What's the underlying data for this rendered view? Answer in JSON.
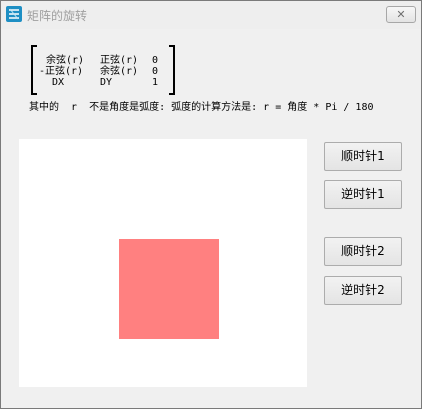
{
  "window": {
    "title": "矩阵的旋转",
    "close_label": "✕"
  },
  "matrix": {
    "rows": [
      [
        "余弦(r)",
        "正弦(r)",
        "0"
      ],
      [
        "-正弦(r)",
        "余弦(r)",
        "0"
      ],
      [
        "DX",
        "DY",
        "1"
      ]
    ]
  },
  "note": "其中的  r  不是角度是弧度: 弧度的计算方法是: r = 角度 * Pi / 180",
  "canvas": {
    "square_color": "#ff8080",
    "background": "#ffffff"
  },
  "buttons": {
    "cw1": "顺时针1",
    "ccw1": "逆时针1",
    "cw2": "顺时针2",
    "ccw2": "逆时针2"
  }
}
